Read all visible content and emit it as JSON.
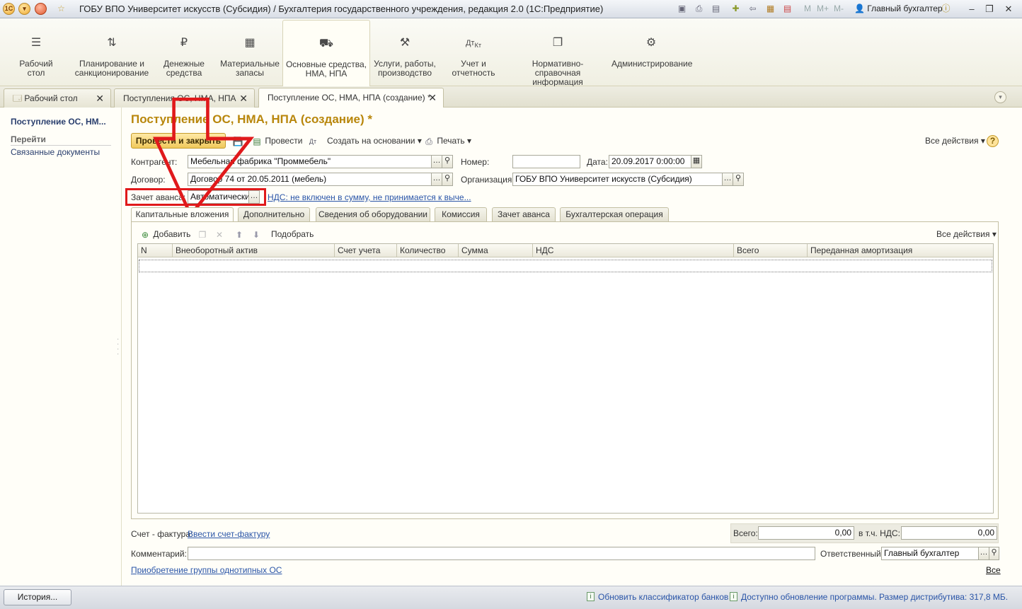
{
  "window": {
    "title": "ГОБУ ВПО Университет искусств (Субсидия) / Бухгалтерия государственного учреждения, редакция 2.0  (1С:Предприятие)",
    "user": "Главный бухгалтер",
    "m_buttons": [
      "M",
      "M+",
      "M-"
    ]
  },
  "sections": [
    {
      "label": "Рабочий стол",
      "icon": "menu-icon"
    },
    {
      "label": "Планирование и санкционирование",
      "icon": "planning-icon"
    },
    {
      "label": "Денежные средства",
      "icon": "ruble-icon"
    },
    {
      "label": "Материальные запасы",
      "icon": "grid-icon"
    },
    {
      "label": "Основные средства, НМА, НПА",
      "icon": "truck-icon"
    },
    {
      "label": "Услуги, работы, производство",
      "icon": "tools-icon"
    },
    {
      "label": "Учет и отчетность",
      "icon": "debit-credit-icon"
    },
    {
      "label": "Нормативно-справочная информация",
      "icon": "documents-icon"
    },
    {
      "label": "Администрирование",
      "icon": "gear-icon"
    }
  ],
  "tabs": [
    {
      "label": "Рабочий стол"
    },
    {
      "label": "Поступления ОС, НМА, НПА"
    },
    {
      "label": "Поступление ОС, НМА, НПА (создание) *"
    }
  ],
  "left_panel": {
    "title": "Поступление ОС, НМ...",
    "goto_header": "Перейти",
    "related_link": "Связанные документы"
  },
  "form": {
    "title": "Поступление ОС, НМА, НПА (создание) *",
    "post_close": "Провести и закрыть",
    "post": "Провести",
    "create_based": "Создать на основании",
    "print": "Печать",
    "all_actions": "Все действия",
    "help": "?"
  },
  "fields": {
    "kontragent_label": "Контрагент:",
    "kontragent_value": "Мебельная фабрика \"Проммебель\"",
    "nomer_label": "Номер:",
    "nomer_value": "",
    "data_label": "Дата:",
    "data_value": "20.09.2017  0:00:00",
    "dogovor_label": "Договор:",
    "dogovor_value": "Договор 74 от 20.05.2011 (мебель)",
    "org_label": "Организация:",
    "org_value": "ГОБУ ВПО Университет искусств (Субсидия)",
    "zachet_label": "Зачет аванса:",
    "zachet_value": "Автоматически",
    "nds_link": "НДС: не включен в сумму, не принимается к выче..."
  },
  "subtabs": [
    {
      "label": "Капитальные вложения"
    },
    {
      "label": "Дополнительно"
    },
    {
      "label": "Сведения об оборудовании"
    },
    {
      "label": "Комиссия"
    },
    {
      "label": "Зачет аванса"
    },
    {
      "label": "Бухгалтерская операция"
    }
  ],
  "table_toolbar": {
    "add": "Добавить",
    "pick": "Подобрать",
    "all_actions": "Все действия"
  },
  "table": {
    "columns": [
      "N",
      "Внеоборотный актив",
      "Счет учета",
      "Количество",
      "Сумма",
      "НДС",
      "Всего",
      "Переданная амортизация"
    ],
    "rows": []
  },
  "bottom": {
    "invoice_label": "Счет - фактура:",
    "invoice_link": "Ввести счет-фактуру",
    "total_label": "Всего:",
    "total_value": "0,00",
    "vat_label": "в т.ч. НДС:",
    "vat_value": "0,00",
    "comment_label": "Комментарий:",
    "comment_value": "",
    "responsible_label": "Ответственный:",
    "responsible_value": "Главный бухгалтер",
    "group_link": "Приобретение группы однотипных ОС",
    "all_link": "Все"
  },
  "status": {
    "history": "История...",
    "update_banks": "Обновить классификатор банков",
    "update_program": "Доступно обновление программы. Размер дистрибутива: 317,8 МБ."
  },
  "colors": {
    "title_accent": "#b8860b",
    "highlight": "#e0191b",
    "link": "#2a55a8"
  }
}
